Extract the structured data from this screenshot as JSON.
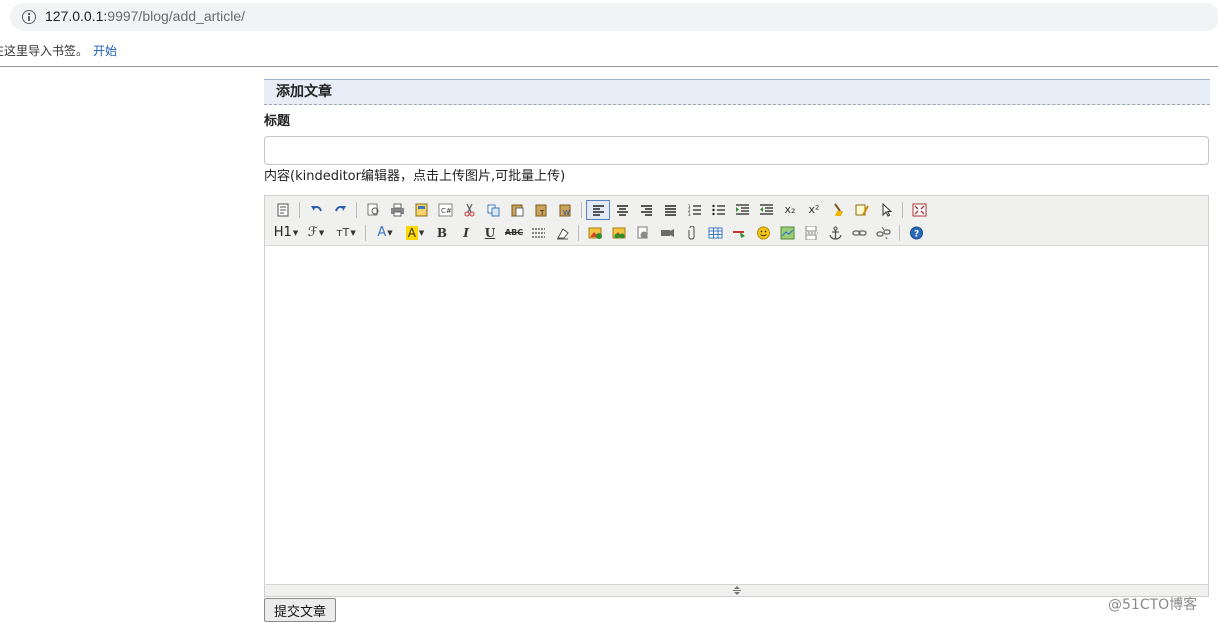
{
  "browser": {
    "url_host": "127.0.0.1:",
    "url_path": "9997/blog/add_article/"
  },
  "bookmarks": {
    "import_text": "在这里导入书签。",
    "start_link": "开始"
  },
  "panel": {
    "heading": "添加文章",
    "title_label": "标题",
    "title_value": "",
    "content_label": "内容(kindeditor编辑器，点击上传图片,可批量上传)"
  },
  "toolbar": {
    "row1": [
      "source-icon",
      "undo-icon",
      "redo-icon",
      "preview-icon",
      "print-icon",
      "template-icon",
      "code-icon",
      "cut-icon",
      "copy-icon",
      "paste-icon",
      "paste-plain-icon",
      "paste-word-icon",
      "align-left-icon",
      "align-center-icon",
      "align-right-icon",
      "align-justify-icon",
      "ordered-list-icon",
      "unordered-list-icon",
      "indent-icon",
      "outdent-icon",
      "subscript-icon",
      "superscript-icon",
      "clear-html-icon",
      "quick-format-icon",
      "select-all-icon",
      "fullscreen-icon"
    ],
    "row2": [
      "heading-icon",
      "font-name-icon",
      "font-size-icon",
      "fore-color-icon",
      "hilite-color-icon",
      "bold-icon",
      "italic-icon",
      "underline-icon",
      "strikethrough-icon",
      "line-height-icon",
      "remove-format-icon",
      "image-icon",
      "multi-image-icon",
      "flash-icon",
      "media-icon",
      "insert-file-icon",
      "table-icon",
      "horizontal-rule-icon",
      "emoticons-icon",
      "baidu-map-icon",
      "page-break-icon",
      "anchor-icon",
      "link-icon",
      "unlink-icon",
      "about-icon"
    ],
    "labels": {
      "heading": "H1",
      "font_name": "ℱ",
      "font_size": "тT",
      "fore_color": "A",
      "hilite_color": "A",
      "bold": "B",
      "italic": "I",
      "underline": "U",
      "strike": "ABC",
      "subscript": "x₂",
      "superscript": "x²"
    },
    "accent_color": "#5b83c4"
  },
  "editor": {
    "content": ""
  },
  "submit": {
    "label": "提交文章"
  },
  "watermark": "@51CTO博客"
}
